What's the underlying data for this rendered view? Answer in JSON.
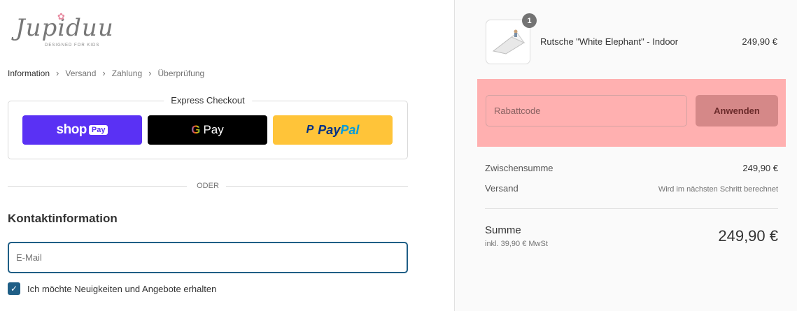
{
  "brand": {
    "logo_text": "Jupiduu",
    "tagline": "DESIGNED FOR KIDS"
  },
  "breadcrumb": [
    "Information",
    "Versand",
    "Zahlung",
    "Überprüfung"
  ],
  "express": {
    "title": "Express Checkout",
    "shop_pay": {
      "shop": "shop",
      "pay": "Pay"
    },
    "google_pay": {
      "g": "G",
      "pay": "Pay"
    },
    "paypal": {
      "pay": "Pay",
      "pal": "Pal"
    }
  },
  "divider_text": "ODER",
  "contact": {
    "title": "Kontaktinformation",
    "email_placeholder": "E-Mail",
    "newsletter_label": "Ich möchte Neuigkeiten und Angebote erhalten",
    "newsletter_checked": true
  },
  "cart": {
    "item": {
      "quantity": "1",
      "name": "Rutsche \"White Elephant\" - Indoor",
      "price": "249,90 €"
    },
    "discount": {
      "placeholder": "Rabattcode",
      "apply_label": "Anwenden"
    },
    "subtotal": {
      "label": "Zwischensumme",
      "value": "249,90 €"
    },
    "shipping": {
      "label": "Versand",
      "value": "Wird im nächsten Schritt berechnet"
    },
    "total": {
      "label": "Summe",
      "tax": "inkl. 39,90 € MwSt",
      "value": "249,90 €"
    }
  },
  "colors": {
    "accent": "#1f5e86",
    "shop_pay": "#5a31f4",
    "paypal": "#ffc439",
    "highlight": "#ffb0b0"
  }
}
